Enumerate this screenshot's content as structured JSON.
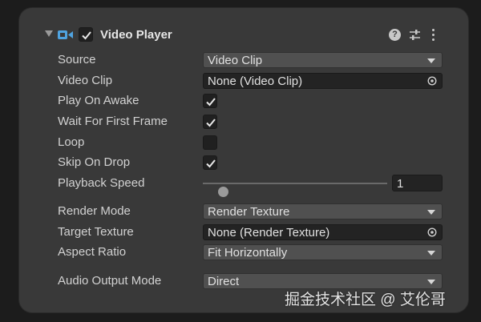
{
  "component": {
    "title": "Video Player",
    "enabled": true
  },
  "fields": {
    "source": {
      "label": "Source",
      "value": "Video Clip"
    },
    "video_clip": {
      "label": "Video Clip",
      "value": "None (Video Clip)"
    },
    "play_on_awake": {
      "label": "Play On Awake",
      "checked": true
    },
    "wait_for_first_frame": {
      "label": "Wait For First Frame",
      "checked": true
    },
    "loop": {
      "label": "Loop",
      "checked": false
    },
    "skip_on_drop": {
      "label": "Skip On Drop",
      "checked": true
    },
    "playback_speed": {
      "label": "Playback Speed",
      "value": "1",
      "slider_fraction": 0.11
    },
    "render_mode": {
      "label": "Render Mode",
      "value": "Render Texture"
    },
    "target_texture": {
      "label": "Target Texture",
      "value": "None (Render Texture)"
    },
    "aspect_ratio": {
      "label": "Aspect Ratio",
      "value": "Fit Horizontally"
    },
    "audio_output_mode": {
      "label": "Audio Output Mode",
      "value": "Direct"
    }
  },
  "header_icons": {
    "help": "help-icon",
    "presets": "presets-icon",
    "menu": "more-vertical-icon"
  },
  "watermark": {
    "text": "掘金技术社区 @ 艾伦哥"
  },
  "colors": {
    "panel": "#393939",
    "dropdown": "#505050",
    "field": "#232323",
    "accent_icon": "#4fa3e0"
  }
}
